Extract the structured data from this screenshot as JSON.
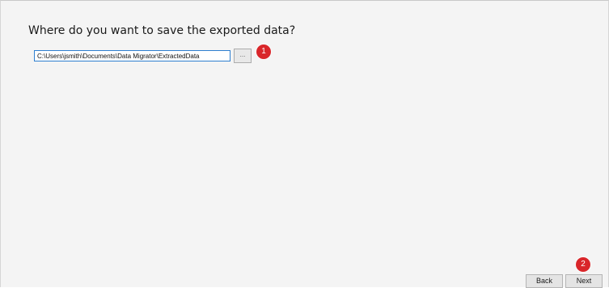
{
  "page": {
    "heading": "Where do you want to save the exported data?"
  },
  "destination": {
    "path_value": "C:\\Users\\jsmith\\Documents\\Data Migrator\\ExtractedData",
    "browse_label": "..."
  },
  "annotations": {
    "badge_1": "1",
    "badge_2": "2",
    "badge_color": "#d9262a"
  },
  "footer": {
    "back_label": "Back",
    "next_label": "Next"
  },
  "colors": {
    "background": "#f4f4f4",
    "input_focus_border": "#2f7fd0"
  }
}
